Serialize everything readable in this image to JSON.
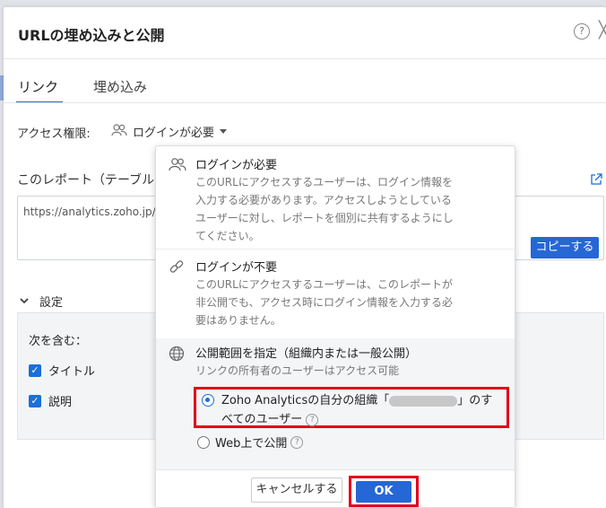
{
  "dialog": {
    "title": "URLの埋め込みと公開",
    "help_glyph": "?",
    "close_glyph": "╳"
  },
  "tabs": [
    {
      "label": "リンク",
      "active": true
    },
    {
      "label": "埋め込み",
      "active": false
    }
  ],
  "access": {
    "label": "アクセス権限:",
    "value": "ログインが必要"
  },
  "report": {
    "label": "このレポート（テーブル",
    "url": "https://analytics.zoho.jp/",
    "copy_label": "コピーする"
  },
  "settings": {
    "label": "設定",
    "include_label": "次を含む：",
    "checkboxes": [
      {
        "label": "タイトル",
        "checked": true
      },
      {
        "label": "説明",
        "checked": true
      }
    ]
  },
  "popup": {
    "options": [
      {
        "title": "ログインが必要",
        "desc": "このURLにアクセスするユーザーは、ログイン情報を入力する必要があります。アクセスしようとしているユーザーに対し、レポートを個別に共有するようにしてください。",
        "icon": "users-icon"
      },
      {
        "title": "ログインが不要",
        "desc": "このURLにアクセスするユーザーは、このレポートが非公開でも、アクセス時にログイン情報を入力する必要はありません。",
        "icon": "link-icon"
      }
    ],
    "public": {
      "title": "公開範囲を指定（組織内または一般公開）",
      "desc": "リンクの所有者のユーザーはアクセス可能",
      "radio_org_prefix": "Zoho Analyticsの自分の組織「",
      "radio_org_suffix": "」のすべてのユーザー",
      "radio_web": "Web上で公開",
      "selected": "org",
      "help_glyph": "?"
    },
    "cancel_label": "キャンセルする",
    "ok_label": "OK"
  },
  "colors": {
    "accent": "#2567d4",
    "highlight": "#e3001b"
  }
}
